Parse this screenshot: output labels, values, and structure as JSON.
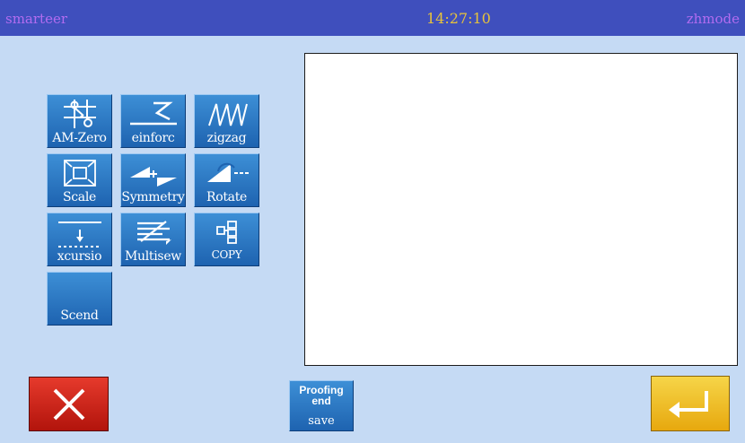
{
  "header": {
    "brand": "smarteer",
    "clock": "14:27:10",
    "mode": "zhmode"
  },
  "functions": [
    {
      "label": "AM-Zero",
      "icon": "am-zero-icon"
    },
    {
      "label": "einforc",
      "icon": "reinforce-icon"
    },
    {
      "label": "zigzag",
      "icon": "zigzag-icon"
    },
    {
      "label": "Scale",
      "icon": "scale-icon"
    },
    {
      "label": "Symmetry",
      "icon": "symmetry-icon"
    },
    {
      "label": "Rotate",
      "icon": "rotate-icon"
    },
    {
      "label": "xcursio",
      "icon": "xcursion-icon"
    },
    {
      "label": "Multisew",
      "icon": "multisew-icon"
    },
    {
      "label": "COPY",
      "icon": "copy-icon"
    },
    {
      "label": "Scend",
      "icon": ""
    }
  ],
  "footer": {
    "proof_line1": "Proofing",
    "proof_line2": "end",
    "proof_line3": "save"
  },
  "colors": {
    "background": "#c5daf4",
    "header": "#3f4fbd",
    "header_text": "#b26cf0",
    "clock_text": "#e8c33a",
    "button_blue": "#1e63b0",
    "cancel_red": "#d42a1e",
    "confirm_yellow": "#f2c32c"
  }
}
